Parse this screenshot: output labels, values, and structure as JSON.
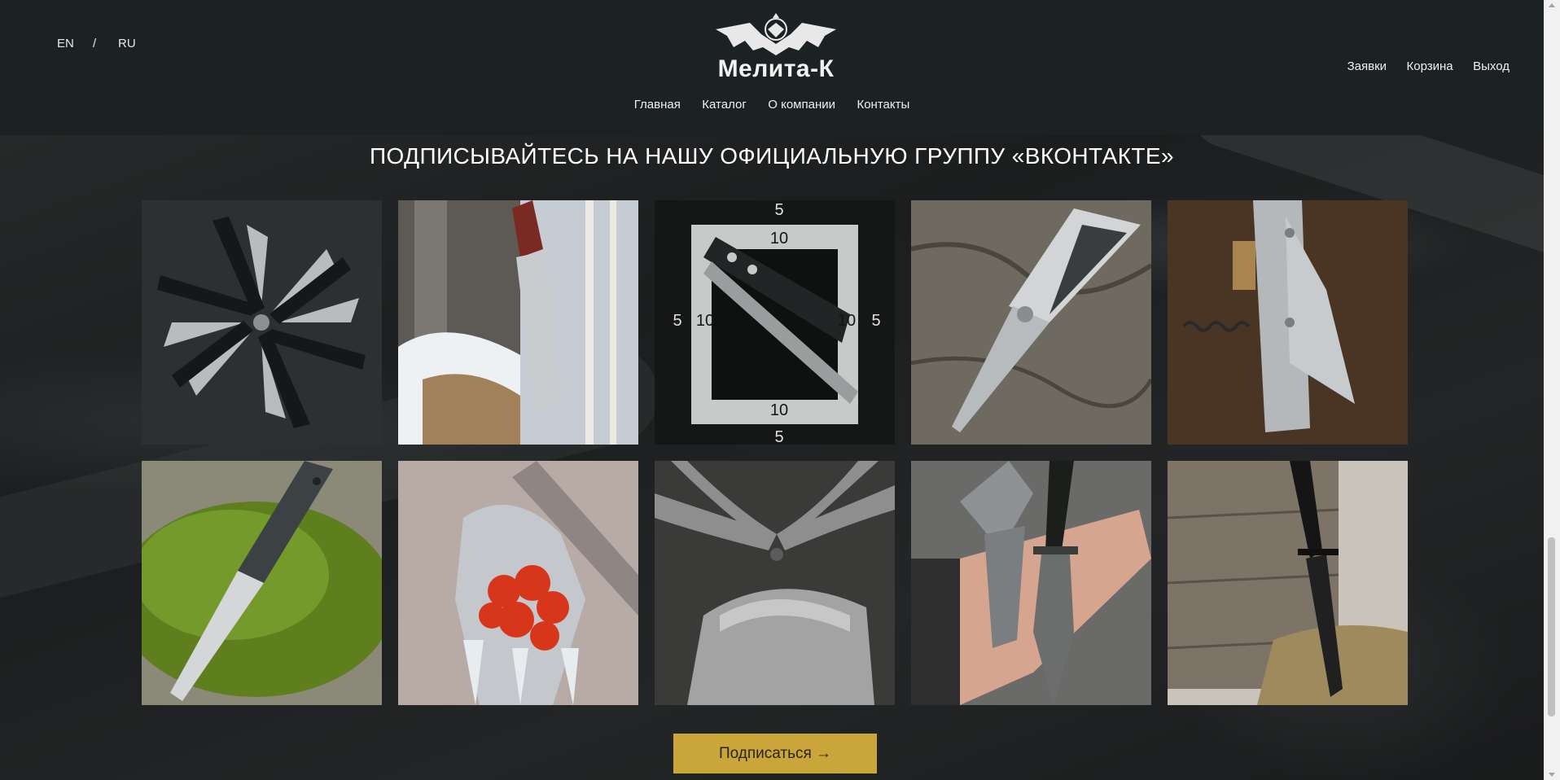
{
  "header": {
    "lang_en": "EN",
    "lang_separator": "/",
    "lang_ru": "RU",
    "logo_text": "Мелита-К",
    "nav": [
      "Главная",
      "Каталог",
      "О компании",
      "Контакты"
    ],
    "actions": [
      "Заявки",
      "Корзина",
      "Выход"
    ]
  },
  "main": {
    "heading": "ПОДПИСЫВАЙТЕСЬ НА НАШУ ОФИЦИАЛЬНУЮ ГРУППУ «ВКОНТАКТЕ»",
    "gallery": [
      {
        "name": "folding-knives-fan-photo"
      },
      {
        "name": "hunting-knife-birch-photo"
      },
      {
        "name": "throwing-knives-target-photo"
      },
      {
        "name": "folding-knife-rock-photo"
      },
      {
        "name": "multitool-corkscrew-photo"
      },
      {
        "name": "knife-moss-photo"
      },
      {
        "name": "frozen-rowan-photo"
      },
      {
        "name": "karambit-knives-photo"
      },
      {
        "name": "knives-in-hand-photo"
      },
      {
        "name": "black-knife-crate-photo"
      }
    ],
    "target_numbers": [
      "5",
      "10",
      "10",
      "5",
      "5",
      "10",
      "10",
      "5"
    ],
    "subscribe_label": "Подписаться →"
  },
  "colors": {
    "header_bg": "#1c2224",
    "accent": "#c9a53a",
    "heading_text": "#ffffff"
  }
}
